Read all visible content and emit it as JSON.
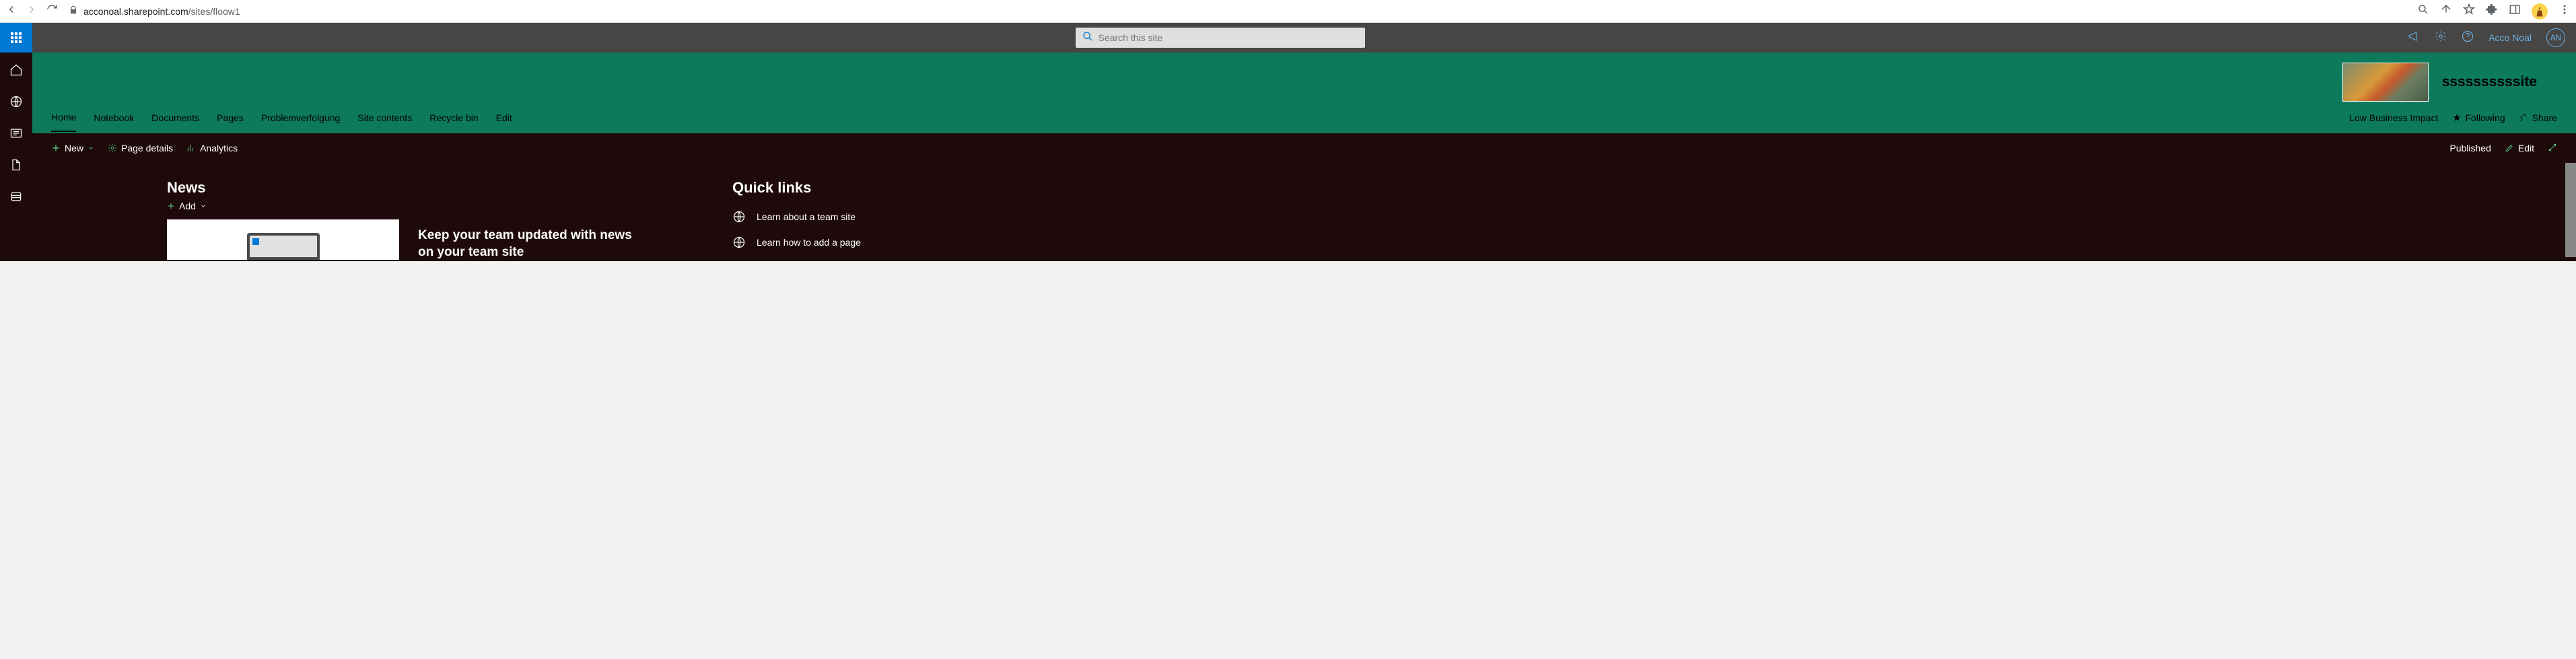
{
  "browser": {
    "url_domain": "acconoal.sharepoint.com",
    "url_path": "/sites/floow1"
  },
  "suite": {
    "search_placeholder": "Search this site",
    "username": "Acco Noal",
    "user_initials": "AN"
  },
  "site": {
    "title": "ssssssssssite",
    "nav": [
      "Home",
      "Notebook",
      "Documents",
      "Pages",
      "Problemverfolgung",
      "Site contents",
      "Recycle bin",
      "Edit"
    ],
    "classification": "Low Business Impact",
    "following": "Following",
    "share": "Share"
  },
  "command": {
    "new": "New",
    "page_details": "Page details",
    "analytics": "Analytics",
    "published": "Published",
    "edit": "Edit"
  },
  "page": {
    "news_heading": "News",
    "add": "Add",
    "news_title": "Keep your team updated with news on your team site",
    "quicklinks_heading": "Quick links",
    "quicklinks": [
      "Learn about a team site",
      "Learn how to add a page"
    ]
  }
}
